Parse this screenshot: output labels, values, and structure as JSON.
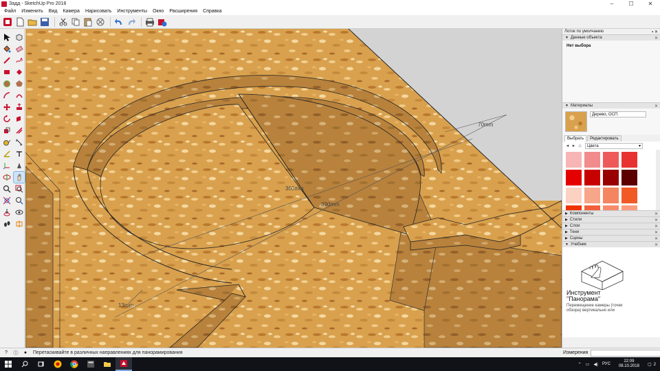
{
  "window": {
    "title": "Задд - SketchUp Pro 2018",
    "controls": [
      "–",
      "☐",
      "✕"
    ]
  },
  "menu": [
    "Файл",
    "Изменить",
    "Вид",
    "Камера",
    "Нарисовать",
    "Инструменты",
    "Окно",
    "Расширения",
    "Справка"
  ],
  "toolbar": {
    "icons": [
      "getting-started",
      "new",
      "open",
      "save",
      "cut",
      "copy",
      "paste",
      "erase",
      "undo",
      "redo",
      "print",
      "model-info"
    ]
  },
  "tools": [
    "select-arrow",
    "component",
    "paint-bucket",
    "eraser",
    "line-pencil",
    "freehand",
    "rectangle",
    "rotated-rectangle",
    "circle",
    "polygon",
    "arc",
    "two-point-arc",
    "move",
    "push-pull",
    "rotate",
    "follow-me",
    "scale",
    "offset",
    "tape-measure",
    "dimension",
    "protractor",
    "text",
    "axes",
    "3d-text",
    "orbit",
    "pan",
    "zoom",
    "zoom-window",
    "zoom-extents",
    "previous",
    "position-camera",
    "look-around",
    "walk",
    "section-plane"
  ],
  "active_tool": "pan",
  "viewport": {
    "dimensions": [
      "70mm",
      "360mm",
      "390mm",
      "13mm"
    ],
    "wood_color": "#d9a14e",
    "sky_color": "#d3d3d3"
  },
  "tray": {
    "title": "Лоток по умолчанию",
    "entity_info": {
      "header": "Данные объекта",
      "no_selection": "Нет выбора"
    },
    "materials": {
      "header": "Материалы",
      "material_name": "Дерево, ОСП",
      "tabs": [
        "Выбрать",
        "Редактировать"
      ],
      "library": "Цвета",
      "swatches": [
        "#f7b5b5",
        "#f28b8b",
        "#ee5a5a",
        "#e83232",
        "#e50000",
        "#c70000",
        "#990000",
        "#5c0000",
        "#fbd1c2",
        "#f7a68a",
        "#f48560",
        "#f15a24",
        "#ee3300",
        "#f25f3a",
        "#f78c6c",
        "#fb9c7c"
      ]
    },
    "collapsed": [
      "Компоненты",
      "Стили",
      "Слои",
      "Тени",
      "Сцены"
    ],
    "instructor": {
      "header": "Учебник",
      "title_line1": "Инструмент",
      "title_line2": "\"Панорама\"",
      "desc_line1": "Перемещение камеры (точки",
      "desc_line2": "обзора) вертикально или"
    }
  },
  "status": {
    "text": "Перетаскивайте в различных направлениях для панорамирования",
    "measure_label": "Измерения",
    "measure_value": ""
  },
  "taskbar": {
    "apps": [
      "start",
      "search",
      "task-view",
      "sketchup-color",
      "chrome",
      "calculator",
      "explorer",
      "sketchup"
    ],
    "lang": "РУС",
    "time": "22:09",
    "date": "08.10.2018",
    "notifications": "2"
  }
}
